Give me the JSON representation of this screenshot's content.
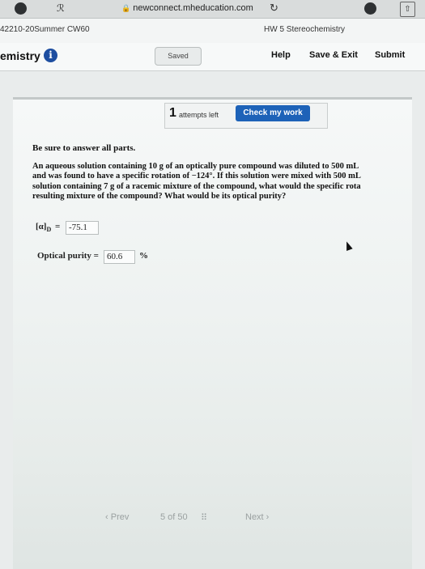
{
  "browser": {
    "url": "newconnect.mheducation.com"
  },
  "course_bar": {
    "course": "42210-20Summer CW60",
    "assignment": "HW 5 Stereochemistry"
  },
  "header": {
    "title": "emistry",
    "saved_label": "Saved",
    "help_label": "Help",
    "save_exit_label": "Save & Exit",
    "submit_label": "Submit"
  },
  "attempts": {
    "count": "1",
    "label": "attempts left"
  },
  "check_button_label": "Check my work",
  "instructions": "Be sure to answer all parts.",
  "question_lines": [
    "An aqueous solution containing 10 g of an optically pure compound was diluted to 500 mL",
    "and was found to have a specific rotation of −124°. If this solution were mixed with 500 mL",
    "solution containing 7 g of a racemic mixture of the compound, what would the specific rota",
    "resulting mixture of the compound? What would be its optical purity?"
  ],
  "answers": {
    "rotation_label": "[α]",
    "rotation_sub": "D",
    "rotation_eq": "=",
    "rotation_value": "-75.1",
    "purity_label": "Optical purity =",
    "purity_value": "60.6",
    "purity_unit": "%"
  },
  "pager": {
    "prev_label": "Prev",
    "page_text": "5 of 50",
    "next_label": "Next"
  }
}
